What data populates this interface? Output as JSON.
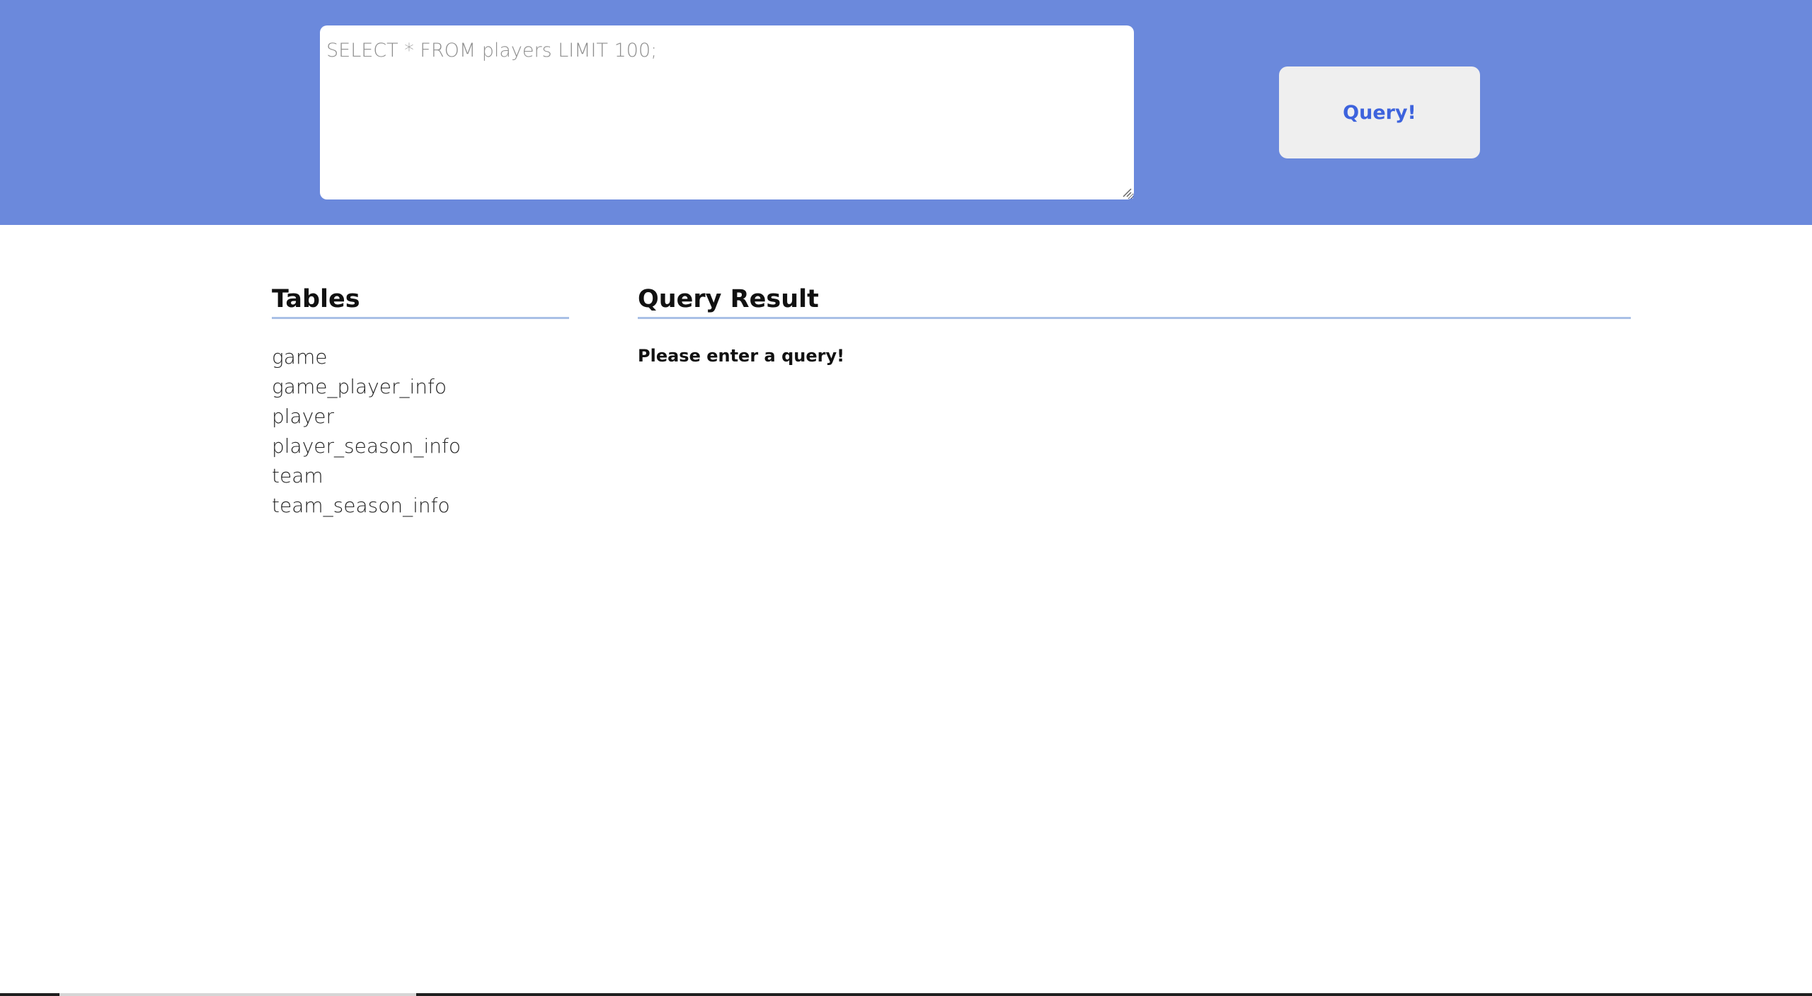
{
  "query": {
    "placeholder": "SELECT * FROM players LIMIT 100;",
    "value": "",
    "button_label": "Query!"
  },
  "tables": {
    "heading": "Tables",
    "items": [
      "game",
      "game_player_info",
      "player",
      "player_season_info",
      "team",
      "team_season_info"
    ]
  },
  "result": {
    "heading": "Query Result",
    "message": "Please enter a query!"
  },
  "colors": {
    "header_bg": "#6b89dc",
    "button_text": "#3d63dd",
    "button_bg": "#efefef",
    "heading_rule": "#a9c0e6"
  }
}
